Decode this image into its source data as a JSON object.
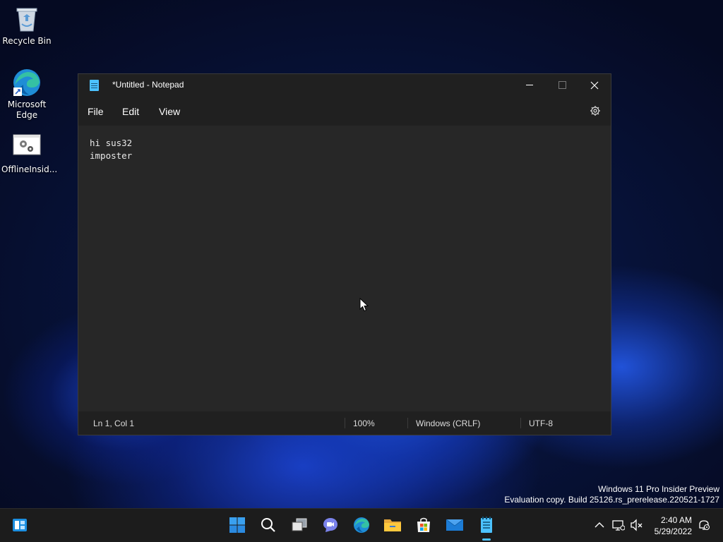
{
  "desktop": {
    "icons": [
      {
        "label": "Recycle Bin"
      },
      {
        "label": "Microsoft Edge"
      },
      {
        "label": "OfflineInsid..."
      }
    ]
  },
  "notepad": {
    "title": "*Untitled - Notepad",
    "menu": {
      "file": "File",
      "edit": "Edit",
      "view": "View"
    },
    "content_line1": "hi sus32",
    "content_line2": "imposter",
    "status": {
      "position": "Ln 1, Col 1",
      "zoom": "100%",
      "line_ending": "Windows (CRLF)",
      "encoding": "UTF-8"
    }
  },
  "watermark": {
    "line1": "Windows 11 Pro Insider Preview",
    "line2": "Evaluation copy. Build 25126.rs_prerelease.220521-1727"
  },
  "taskbar": {
    "pinned": [
      "start-icon",
      "search-icon",
      "task-view-icon",
      "chat-icon",
      "edge-icon",
      "file-explorer-icon",
      "store-icon",
      "mail-icon",
      "notepad-icon"
    ]
  },
  "clock": {
    "time": "2:40 AM",
    "date": "5/29/2022"
  },
  "colors": {
    "accent": "#4cc2ff",
    "window_bg": "#272727",
    "chrome_bg": "#202020",
    "taskbar_bg": "#1c1c1c"
  }
}
